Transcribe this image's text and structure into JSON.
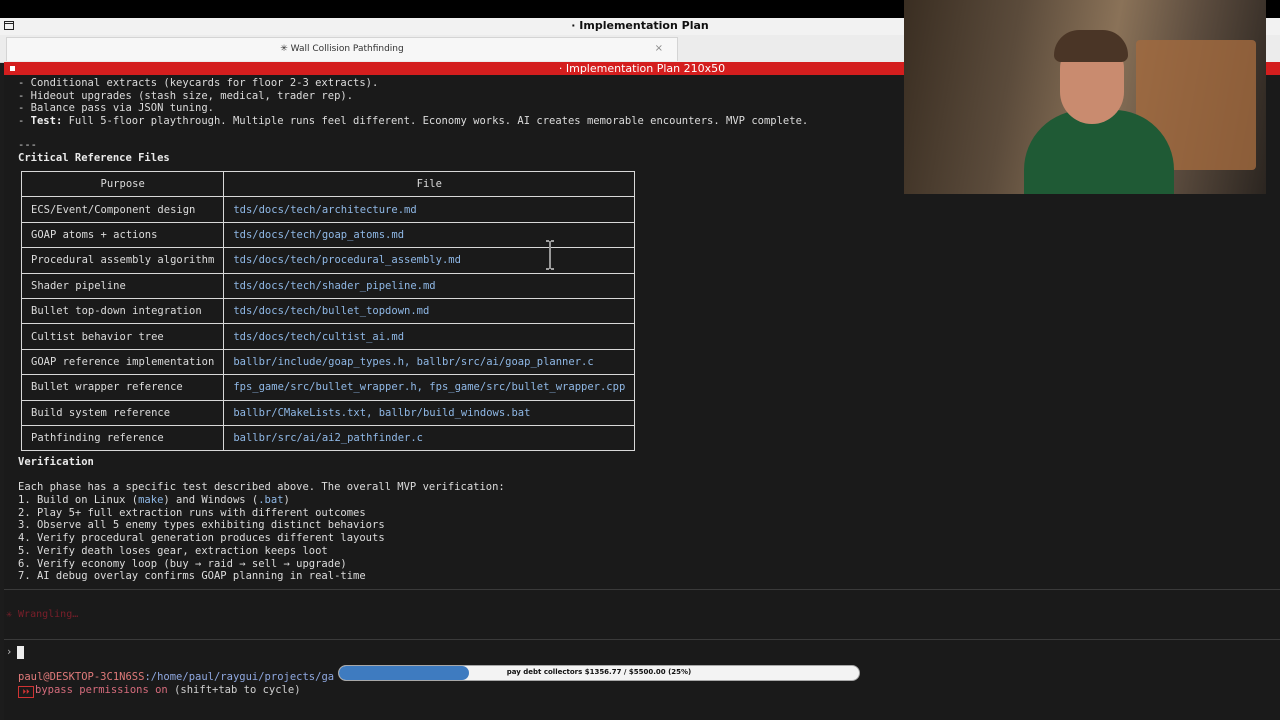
{
  "window": {
    "title": "· Implementation Plan"
  },
  "tab": {
    "label": "✳ Wall Collision Pathfinding",
    "close": "×"
  },
  "terminal_header": {
    "title": "· Implementation Plan 210x50"
  },
  "content": {
    "lines_top": [
      "- Conditional extracts (keycards for floor 2-3 extracts).",
      "- Hideout upgrades (stash size, medical, trader rep).",
      "- Balance pass via JSON tuning."
    ],
    "test_label": "Test:",
    "test_text": " Full 5-floor playthrough. Multiple runs feel different. Economy works. AI creates memorable encounters. MVP complete.",
    "test_prefix": "- ",
    "separator": "---",
    "critical_heading": "Critical Reference Files",
    "table": {
      "headers": [
        "Purpose",
        "File"
      ],
      "rows": [
        [
          "ECS/Event/Component design",
          "tds/docs/tech/architecture.md"
        ],
        [
          "GOAP atoms + actions",
          "tds/docs/tech/goap_atoms.md"
        ],
        [
          "Procedural assembly algorithm",
          "tds/docs/tech/procedural_assembly.md"
        ],
        [
          "Shader pipeline",
          "tds/docs/tech/shader_pipeline.md"
        ],
        [
          "Bullet top-down integration",
          "tds/docs/tech/bullet_topdown.md"
        ],
        [
          "Cultist behavior tree",
          "tds/docs/tech/cultist_ai.md"
        ],
        [
          "GOAP reference implementation",
          "ballbr/include/goap_types.h, ballbr/src/ai/goap_planner.c"
        ],
        [
          "Bullet wrapper reference",
          "fps_game/src/bullet_wrapper.h, fps_game/src/bullet_wrapper.cpp"
        ],
        [
          "Build system reference",
          "ballbr/CMakeLists.txt, ballbr/build_windows.bat"
        ],
        [
          "Pathfinding reference",
          "ballbr/src/ai/ai2_pathfinder.c"
        ]
      ]
    },
    "verification_heading": "Verification",
    "verification_intro": "Each phase has a specific test described above. The overall MVP verification:",
    "verification_1_pre": "1. Build on Linux (",
    "verification_1_make": "make",
    "verification_1_mid": ") and Windows (",
    "verification_1_bat": ".bat",
    "verification_1_post": ")",
    "verification_steps": [
      "2. Play 5+ full extraction runs with different outcomes",
      "3. Observe all 5 enemy types exhibiting distinct behaviors",
      "4. Verify procedural generation produces different layouts",
      "5. Verify death loses gear, extraction keeps loot",
      "6. Verify economy loop (buy → raid → sell → upgrade)",
      "7. AI debug overlay confirms GOAP planning in real-time"
    ]
  },
  "status": {
    "wrangling": "✳ Wrangling…",
    "prompt_symbol": "›",
    "user_host": "paul@DESKTOP-3C1N6SS",
    "path": ":/home/paul/raygui/projects/ga",
    "permissions_icon": "⏵⏵",
    "permissions_text": "bypass permissions on",
    "permissions_hint": " (shift+tab to cycle)"
  },
  "progress": {
    "label": "pay debt collectors $1356.77 / $5500.00 (25%)",
    "fraction": 0.25,
    "color": "#3e7bc0"
  },
  "icons": {
    "window": "window-icon",
    "cursor": "text-cursor-icon"
  }
}
